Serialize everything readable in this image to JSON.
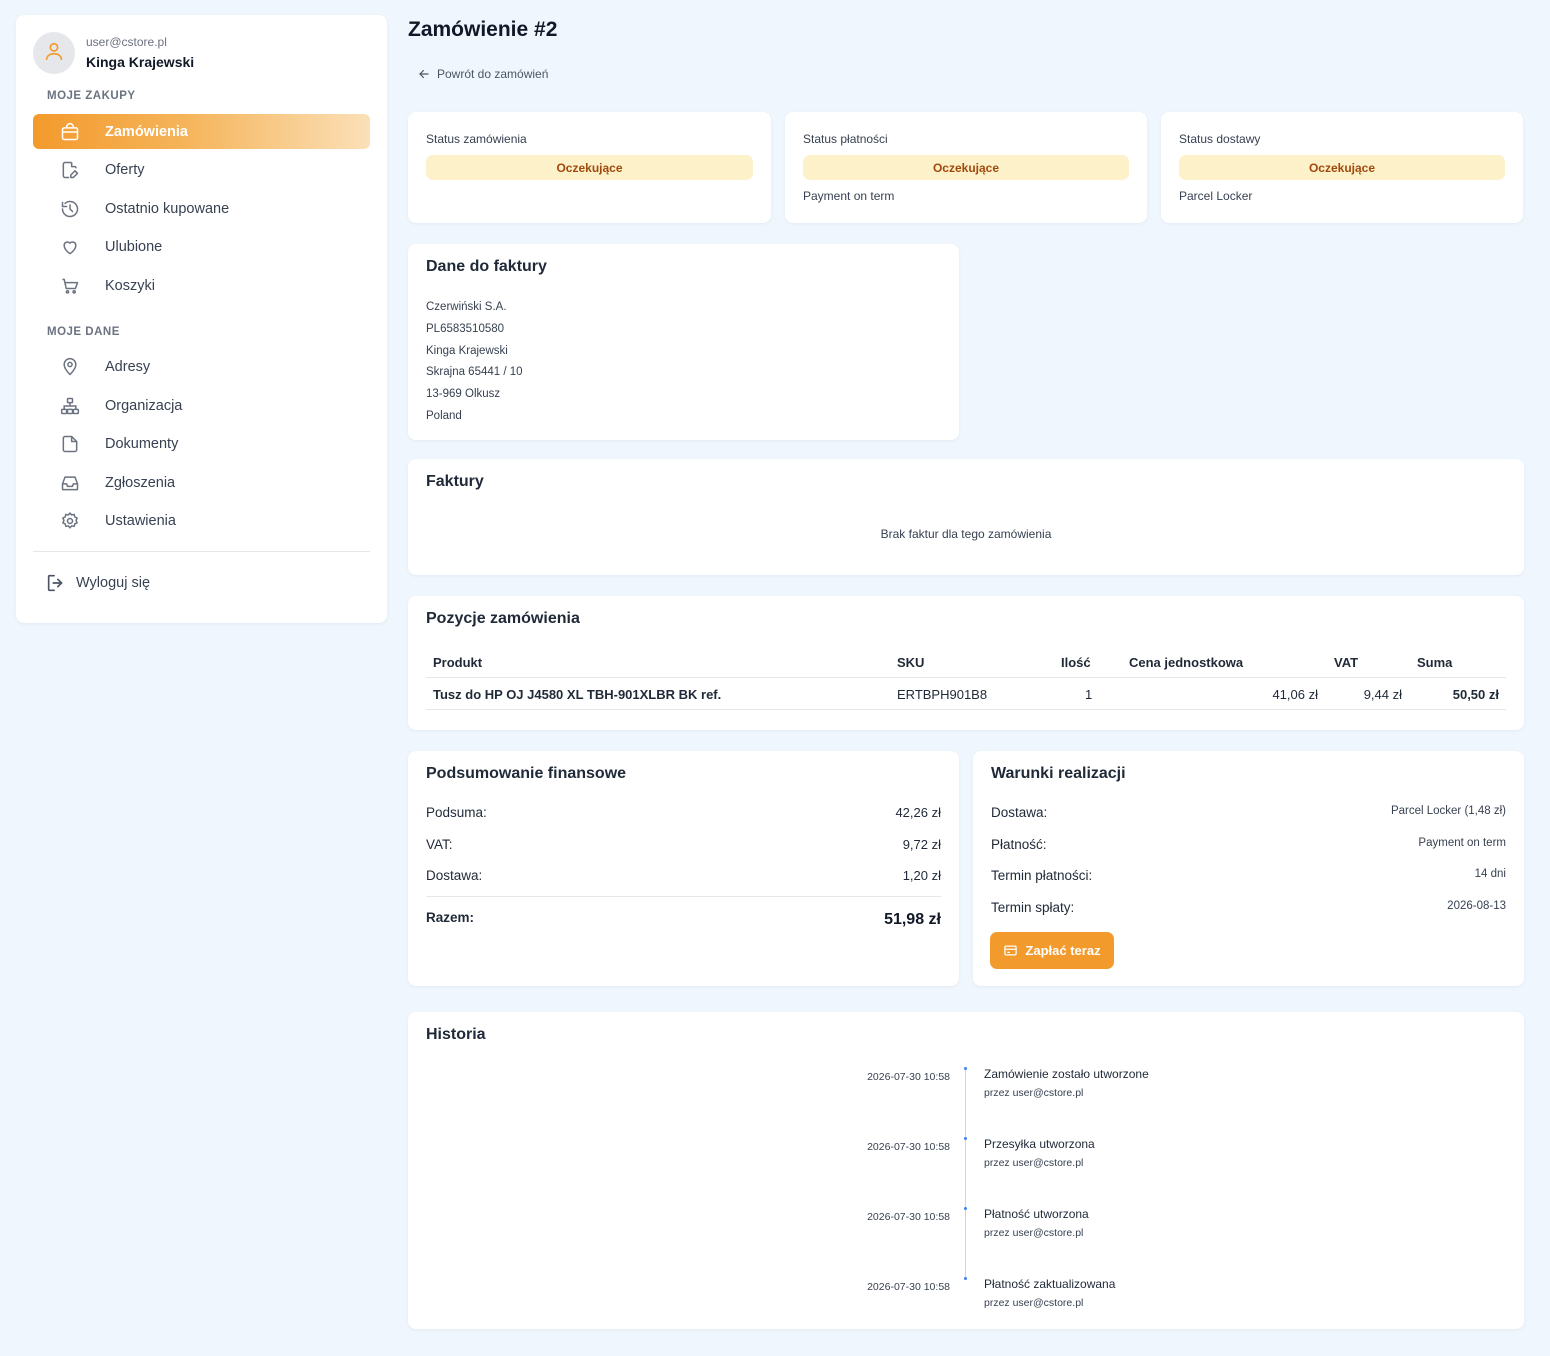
{
  "user": {
    "email": "user@cstore.pl",
    "name": "Kinga Krajewski"
  },
  "sidebar": {
    "section_purchases": "MOJE ZAKUPY",
    "purchases": [
      {
        "label": "Zamówienia",
        "icon": "shopping-bag-icon",
        "active": true
      },
      {
        "label": "Oferty",
        "icon": "file-edit-icon"
      },
      {
        "label": "Ostatnio kupowane",
        "icon": "history-icon"
      },
      {
        "label": "Ulubione",
        "icon": "heart-icon"
      },
      {
        "label": "Koszyki",
        "icon": "cart-icon"
      }
    ],
    "section_data": "MOJE DANE",
    "data": [
      {
        "label": "Adresy",
        "icon": "map-pin-icon"
      },
      {
        "label": "Organizacja",
        "icon": "org-chart-icon"
      },
      {
        "label": "Dokumenty",
        "icon": "document-icon"
      },
      {
        "label": "Zgłoszenia",
        "icon": "inbox-icon"
      },
      {
        "label": "Ustawienia",
        "icon": "gear-icon"
      }
    ],
    "logout": "Wyloguj się"
  },
  "page": {
    "title": "Zamówienie #2",
    "back": "Powrót do zamówień"
  },
  "statuses": [
    {
      "label": "Status zamówienia",
      "value": "Oczekujące",
      "sub": ""
    },
    {
      "label": "Status płatności",
      "value": "Oczekujące",
      "sub": "Payment on term"
    },
    {
      "label": "Status dostawy",
      "value": "Oczekujące",
      "sub": "Parcel Locker"
    }
  ],
  "invoice_data": {
    "title": "Dane do faktury",
    "lines": [
      "Czerwiński S.A.",
      "PL6583510580",
      "Kinga Krajewski",
      "Skrajna 65441 / 10",
      "13-969 Olkusz",
      "Poland"
    ]
  },
  "invoices": {
    "title": "Faktury",
    "empty": "Brak faktur dla tego zamówienia"
  },
  "items": {
    "title": "Pozycje zamówienia",
    "columns": [
      "Produkt",
      "SKU",
      "Ilość",
      "Cena jednostkowa",
      "VAT",
      "Suma"
    ],
    "rows": [
      {
        "product": "Tusz do HP OJ J4580 XL TBH-901XLBR BK ref.",
        "sku": "ERTBPH901B8",
        "qty": "1",
        "unit_price": "41,06 zł",
        "vat": "9,44 zł",
        "total": "50,50 zł"
      }
    ]
  },
  "financial": {
    "title": "Podsumowanie finansowe",
    "rows": [
      {
        "label": "Podsuma:",
        "value": "42,26 zł"
      },
      {
        "label": "VAT:",
        "value": "9,72 zł"
      },
      {
        "label": "Dostawa:",
        "value": "1,20 zł"
      }
    ],
    "total_label": "Razem:",
    "total_value": "51,98 zł"
  },
  "conditions": {
    "title": "Warunki realizacji",
    "rows": [
      {
        "label": "Dostawa:",
        "value": "Parcel Locker (1,48 zł)"
      },
      {
        "label": "Płatność:",
        "value": "Payment on term"
      },
      {
        "label": "Termin płatności:",
        "value": "14 dni"
      },
      {
        "label": "Termin spłaty:",
        "value": "2026-08-13"
      }
    ],
    "pay_button": "Zapłać teraz"
  },
  "history": {
    "title": "Historia",
    "items": [
      {
        "date": "2026-07-30 10:58",
        "title": "Zamówienie zostało utworzone",
        "by": "przez user@cstore.pl"
      },
      {
        "date": "2026-07-30 10:58",
        "title": "Przesyłka utworzona",
        "by": "przez user@cstore.pl"
      },
      {
        "date": "2026-07-30 10:58",
        "title": "Płatność utworzona",
        "by": "przez user@cstore.pl"
      },
      {
        "date": "2026-07-30 10:58",
        "title": "Płatność zaktualizowana",
        "by": "przez user@cstore.pl"
      }
    ]
  },
  "colors": {
    "accent": "#f39a2c",
    "badge_bg": "#fdf1c9",
    "badge_text": "#a0490c",
    "page_bg": "#eff6fd"
  }
}
